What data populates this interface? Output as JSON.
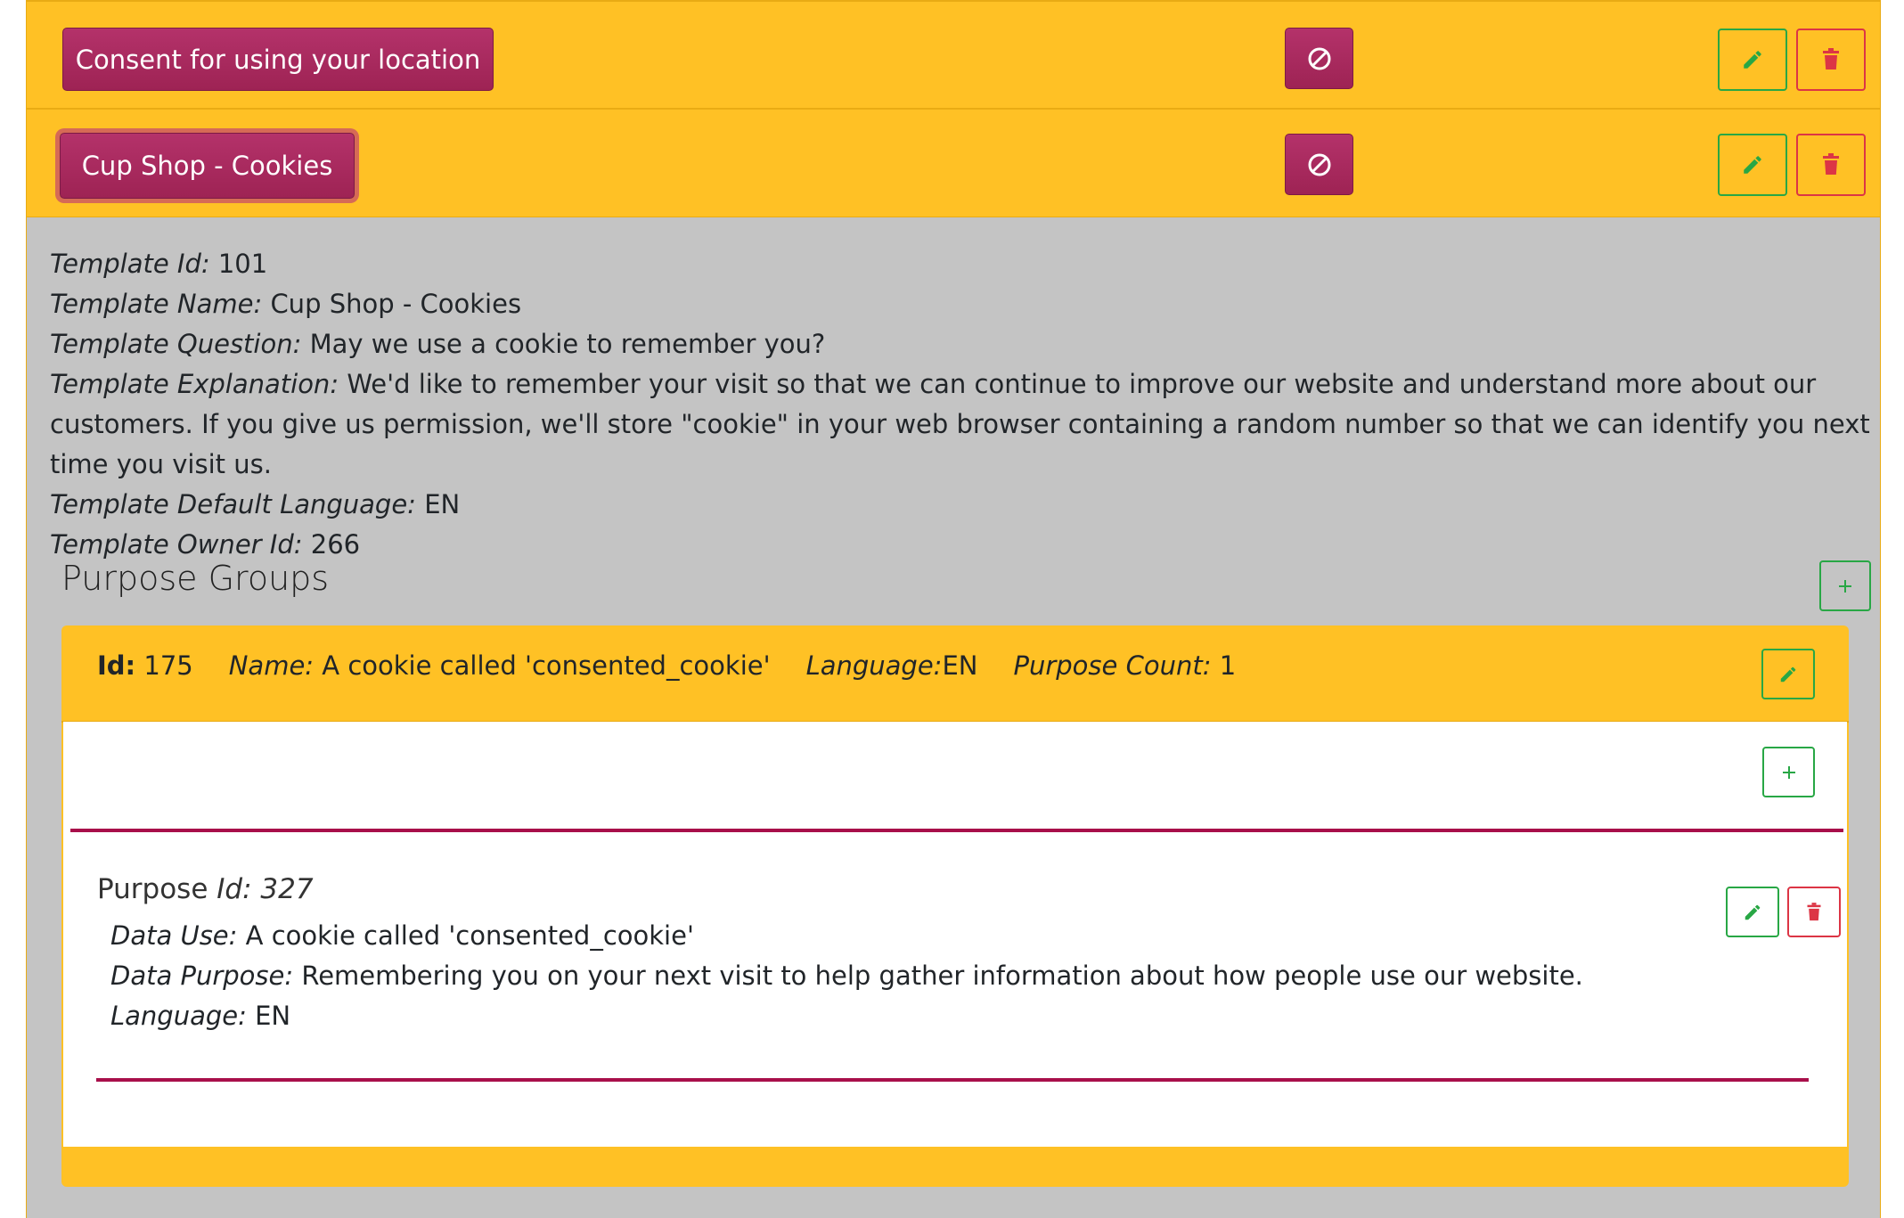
{
  "templates": [
    {
      "name": "Consent for using your location"
    },
    {
      "name": "Cup Shop - Cookies"
    }
  ],
  "icons": {
    "disable": "ban-icon",
    "edit": "pencil-icon",
    "delete": "trash-icon",
    "add": "plus-icon"
  },
  "colors": {
    "bar": "#ffc125",
    "pill": "#a8285c",
    "details_bg": "#c4c4c4",
    "edit": "#28a745",
    "delete": "#dc3545",
    "divider": "#a80f4a"
  },
  "details": {
    "id_label": "Template Id:",
    "id_value": "101",
    "name_label": "Template Name:",
    "name_value": "Cup Shop - Cookies",
    "question_label": "Template Question:",
    "question_value": "May we use a cookie to remember you?",
    "explanation_label": "Template Explanation:",
    "explanation_value": "We'd like to remember your visit so that we can continue to improve our website and understand more about our customers. If you give us permission, we'll store \"cookie\" in your web browser containing a random number so that we can identify you next time you visit us.",
    "language_label": "Template Default Language:",
    "language_value": "EN",
    "owner_label": "Template Owner Id:",
    "owner_value": "266"
  },
  "purpose_groups": {
    "title": "Purpose Groups",
    "group": {
      "id_label": "Id:",
      "id_value": "175",
      "name_label": "Name:",
      "name_value": "A cookie called 'consented_cookie'",
      "language_label": "Language:",
      "language_value": "EN",
      "count_label": "Purpose Count:",
      "count_value": "1"
    },
    "purpose": {
      "title": "Purpose",
      "id_label": "Id:",
      "id_value": "327",
      "data_use_label": "Data Use:",
      "data_use_value": "A cookie called 'consented_cookie'",
      "data_purpose_label": "Data Purpose:",
      "data_purpose_value": "Remembering you on your next visit to help gather information about how people use our website.",
      "language_label": "Language:",
      "language_value": "EN"
    }
  }
}
